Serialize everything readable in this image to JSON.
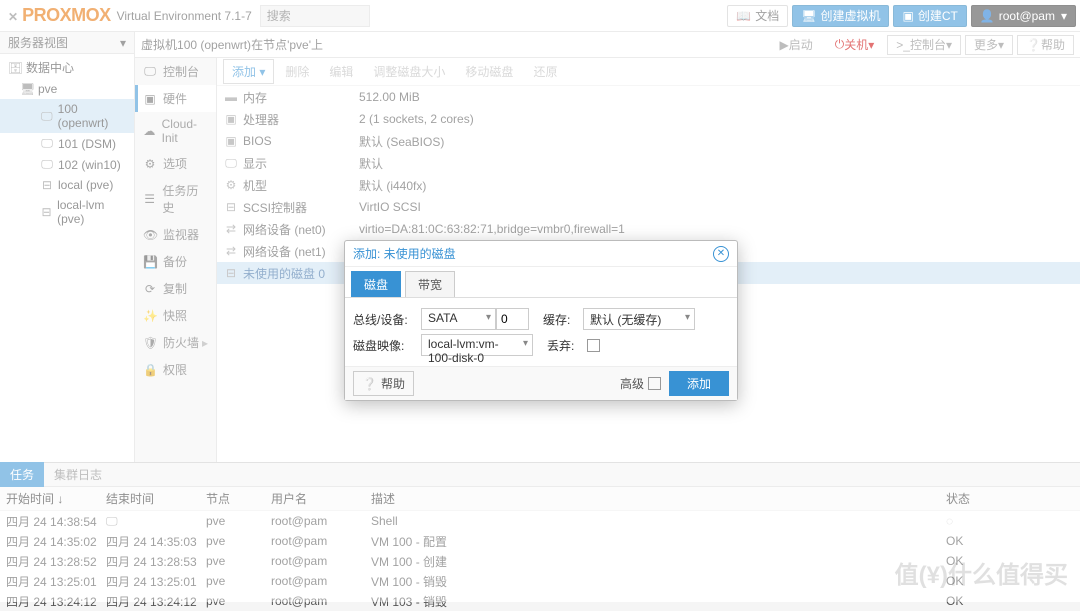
{
  "header": {
    "product": "PROXMOX",
    "subtitle": "Virtual Environment 7.1-7",
    "search_ph": "搜索",
    "doc": "文档",
    "create_vm": "创建虚拟机",
    "create_ct": "创建CT",
    "user": "root@pam"
  },
  "tree": {
    "view": "服务器视图",
    "dc": "数据中心",
    "node": "pve",
    "vm100": "100 (openwrt)",
    "vm101": "101 (DSM)",
    "vm102": "102 (win10)",
    "local": "local (pve)",
    "lvm": "local-lvm (pve)"
  },
  "crumb": {
    "pre": "虚拟机",
    "id": "100 (openwrt)",
    "mid": "在节点'",
    "node": "pve",
    "post": "'上",
    "start": "启动",
    "shutdown": "关机",
    "console": "控制台",
    "more": "更多",
    "help": "帮助"
  },
  "isb": [
    "控制台",
    "硬件",
    "Cloud-Init",
    "选项",
    "任务历史",
    "监视器",
    "备份",
    "复制",
    "快照",
    "防火墙",
    "权限"
  ],
  "toolbar": {
    "add": "添加",
    "remove": "删除",
    "edit": "编辑",
    "resize": "调整磁盘大小",
    "move": "移动磁盘",
    "revert": "还原"
  },
  "hw": [
    {
      "ic": "▬",
      "k": "内存",
      "v": "512.00 MiB"
    },
    {
      "ic": "▣",
      "k": "处理器",
      "v": "2 (1 sockets, 2 cores)"
    },
    {
      "ic": "▣",
      "k": "BIOS",
      "v": "默认 (SeaBIOS)"
    },
    {
      "ic": "🖵",
      "k": "显示",
      "v": "默认"
    },
    {
      "ic": "⚙",
      "k": "机型",
      "v": "默认 (i440fx)"
    },
    {
      "ic": "⊟",
      "k": "SCSI控制器",
      "v": "VirtIO SCSI"
    },
    {
      "ic": "⇄",
      "k": "网络设备 (net0)",
      "v": "virtio=DA:81:0C:63:82:71,bridge=vmbr0,firewall=1"
    },
    {
      "ic": "⇄",
      "k": "网络设备 (net1)",
      "v": "virtio=F6:9B:C3:42:1B:73,bridge=vmbr0,firewall=1"
    },
    {
      "ic": "⊟",
      "k": "未使用的磁盘 0",
      "v": "local-lvm:vm-100-disk-0"
    }
  ],
  "modal": {
    "title": "添加: 未使用的磁盘",
    "tab_disk": "磁盘",
    "tab_bw": "带宽",
    "bus_lbl": "总线/设备:",
    "bus_val": "SATA",
    "bus_num": "0",
    "cache_lbl": "缓存:",
    "cache_val": "默认 (无缓存)",
    "img_lbl": "磁盘映像:",
    "img_val": "local-lvm:vm-100-disk-0",
    "discard_lbl": "丢弃:",
    "help": "帮助",
    "adv": "高级",
    "add": "添加"
  },
  "tasks": {
    "tab_tasks": "任务",
    "tab_cluster": "集群日志",
    "h_start": "开始时间 ↓",
    "h_end": "结束时间",
    "h_node": "节点",
    "h_user": "用户名",
    "h_desc": "描述",
    "h_status": "状态",
    "rows": [
      {
        "st": "四月 24 14:38:54",
        "et": "",
        "nd": "pve",
        "us": "root@pam",
        "ds": "Shell",
        "ok": ""
      },
      {
        "st": "四月 24 14:35:02",
        "et": "四月 24 14:35:03",
        "nd": "pve",
        "us": "root@pam",
        "ds": "VM 100 - 配置",
        "ok": "OK"
      },
      {
        "st": "四月 24 13:28:52",
        "et": "四月 24 13:28:53",
        "nd": "pve",
        "us": "root@pam",
        "ds": "VM 100 - 创建",
        "ok": "OK"
      },
      {
        "st": "四月 24 13:25:01",
        "et": "四月 24 13:25:01",
        "nd": "pve",
        "us": "root@pam",
        "ds": "VM 100 - 销毁",
        "ok": "OK"
      },
      {
        "st": "四月 24 13:24:12",
        "et": "四月 24 13:24:12",
        "nd": "pve",
        "us": "root@pam",
        "ds": "VM 103 - 销毁",
        "ok": "OK"
      }
    ]
  },
  "watermark": "值(¥)什么值得买"
}
